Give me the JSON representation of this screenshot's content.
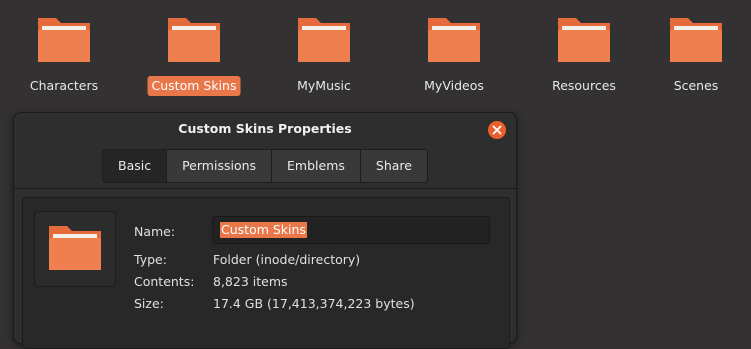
{
  "folders": [
    {
      "label": "Characters",
      "selected": false
    },
    {
      "label": "Custom Skins",
      "selected": true
    },
    {
      "label": "MyMusic",
      "selected": false
    },
    {
      "label": "MyVideos",
      "selected": false
    },
    {
      "label": "Resources",
      "selected": false
    },
    {
      "label": "Scenes",
      "selected": false
    }
  ],
  "dialog": {
    "title": "Custom Skins Properties",
    "close_icon": "close-icon",
    "tabs": [
      "Basic",
      "Permissions",
      "Emblems",
      "Share"
    ],
    "active_tab": "Basic",
    "basic": {
      "name_label": "Name:",
      "name_value": "Custom Skins",
      "type_label": "Type:",
      "type_value": "Folder (inode/directory)",
      "contents_label": "Contents:",
      "contents_value": "8,823 items",
      "size_label": "Size:",
      "size_value": "17.4 GB (17,413,374,223 bytes)"
    }
  },
  "colors": {
    "accent": "#e9774a",
    "folder": "#f07f4f",
    "background": "#333132"
  }
}
